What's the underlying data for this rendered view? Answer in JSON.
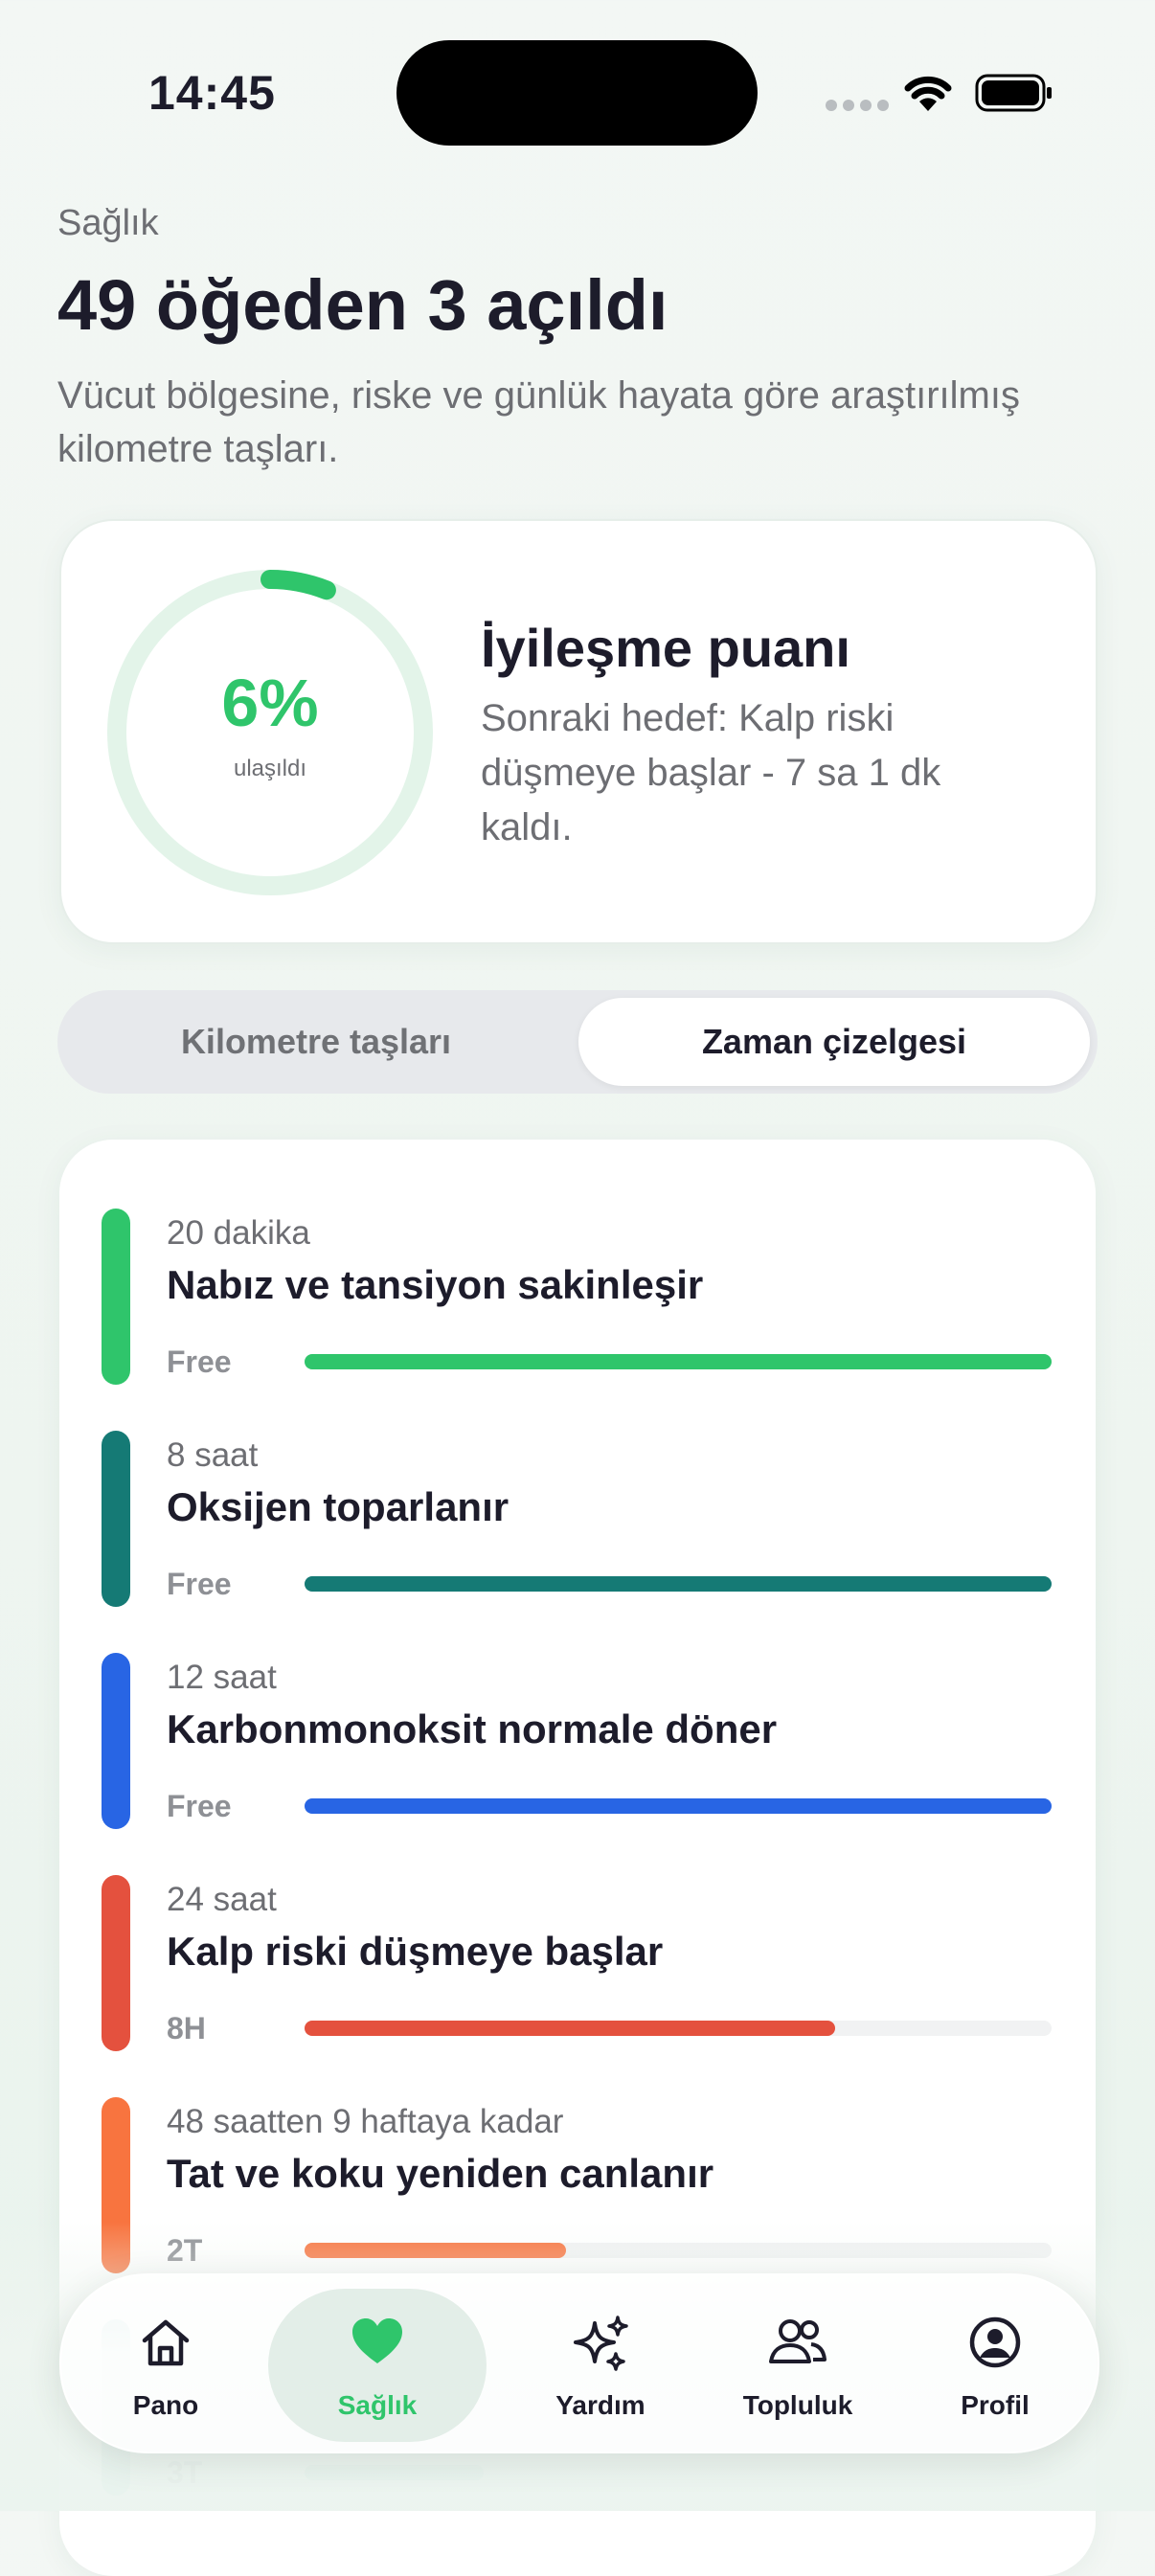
{
  "status_bar": {
    "time": "14:45"
  },
  "header": {
    "eyebrow": "Sağlık",
    "title": "49 öğeden 3 açıldı",
    "subtitle": "Vücut bölgesine, riske ve günlük hayata göre araştırılmış kilometre taşları."
  },
  "score_card": {
    "percent_label": "6%",
    "percent_value": 0.06,
    "caption": "ulaşıldı",
    "title": "İyileşme puanı",
    "description": "Sonraki hedef: Kalp riski düşmeye başlar - 7 sa 1 dk kaldı."
  },
  "segmented": {
    "left_label": "Kilometre taşları",
    "right_label": "Zaman çizelgesi",
    "selected": "right"
  },
  "timeline": [
    {
      "time": "20 dakika",
      "title": "Nabız ve tansiyon sakinleşir",
      "tag": "Free",
      "progress": 1.0,
      "color": "#2fc56b"
    },
    {
      "time": "8 saat",
      "title": "Oksijen toparlanır",
      "tag": "Free",
      "progress": 1.0,
      "color": "#157a75"
    },
    {
      "time": "12 saat",
      "title": "Karbonmonoksit normale döner",
      "tag": "Free",
      "progress": 1.0,
      "color": "#2865e4"
    },
    {
      "time": "24 saat",
      "title": "Kalp riski düşmeye başlar",
      "tag": "8H",
      "progress": 0.71,
      "color": "#e4513e"
    },
    {
      "time": "48 saatten 9 haftaya kadar",
      "title": "Tat ve koku yeniden canlanır",
      "tag": "2T",
      "progress": 0.35,
      "color": "#f8743f"
    },
    {
      "time": "",
      "title": "",
      "tag": "3T",
      "progress": 0.24,
      "color": "#7dc3bd"
    }
  ],
  "tabbar": {
    "tabs": [
      {
        "label": "Pano",
        "icon": "home-icon"
      },
      {
        "label": "Sağlık",
        "icon": "heart-icon",
        "active": true
      },
      {
        "label": "Yardım",
        "icon": "sparkles-icon"
      },
      {
        "label": "Topluluk",
        "icon": "people-icon"
      },
      {
        "label": "Profil",
        "icon": "profile-icon"
      }
    ]
  },
  "colors": {
    "accent": "#2fc56b",
    "text_primary": "#1d1c2b",
    "text_secondary": "#6d6e73"
  }
}
